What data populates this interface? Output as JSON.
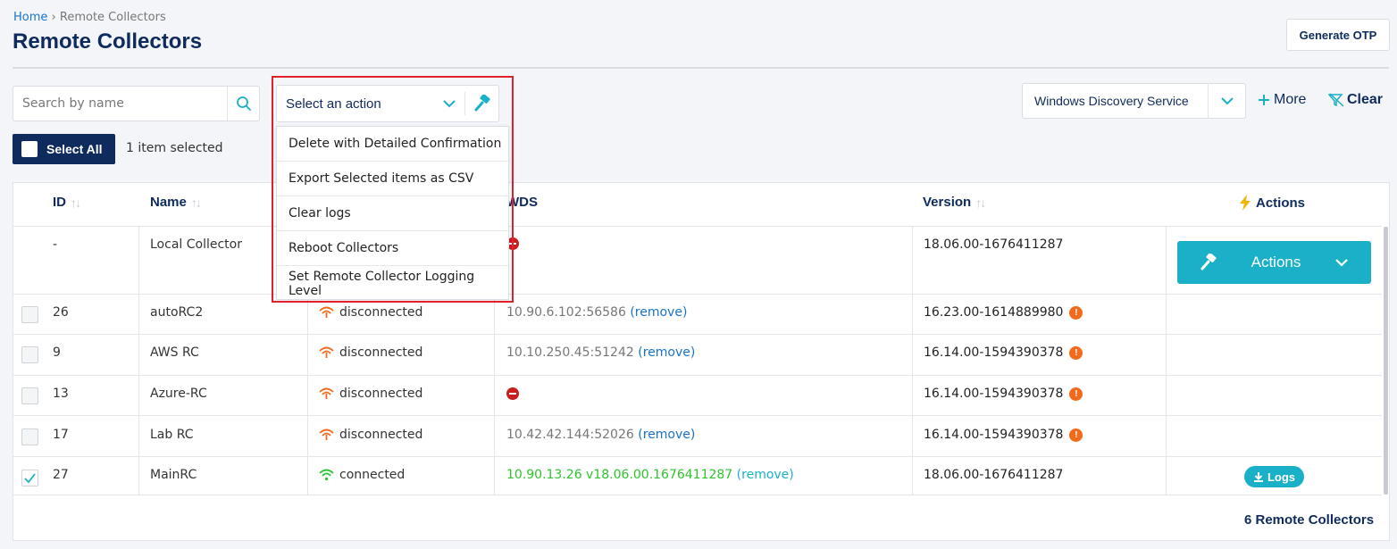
{
  "breadcrumb": {
    "home": "Home",
    "separator": "›",
    "current": "Remote Collectors"
  },
  "page_title": "Remote Collectors",
  "generate_otp_label": "Generate OTP",
  "search": {
    "placeholder": "Search by name"
  },
  "action_select": {
    "label": "Select an action",
    "options": [
      "Delete with Detailed Confirmation",
      "Export Selected items as CSV",
      "Clear logs",
      "Reboot Collectors",
      "Set Remote Collector Logging Level"
    ]
  },
  "filter": {
    "wds_label": "Windows Discovery Service",
    "more_label": "More",
    "clear_label": "Clear"
  },
  "selection": {
    "select_all_label": "Select All",
    "selected_text": "1 item selected"
  },
  "table": {
    "headers": {
      "id": "ID",
      "name": "Name",
      "wds": "WDS",
      "version": "Version",
      "actions": "Actions"
    },
    "rows": [
      {
        "id": "-",
        "name": "Local Collector",
        "status": "",
        "wds": "",
        "wds_remove": "",
        "version": "18.06.00-1676411287"
      },
      {
        "id": "26",
        "name": "autoRC2",
        "status": "disconnected",
        "wds": "10.90.6.102:56586",
        "wds_remove": "(remove)",
        "version": "16.23.00-1614889980"
      },
      {
        "id": "9",
        "name": "AWS RC",
        "status": "disconnected",
        "wds": "10.10.250.45:51242",
        "wds_remove": "(remove)",
        "version": "16.14.00-1594390378"
      },
      {
        "id": "13",
        "name": "Azure-RC",
        "status": "disconnected",
        "wds": "",
        "wds_remove": "",
        "version": "16.14.00-1594390378"
      },
      {
        "id": "17",
        "name": "Lab RC",
        "status": "disconnected",
        "wds": "10.42.42.144:52026",
        "wds_remove": "(remove)",
        "version": "16.14.00-1594390378"
      },
      {
        "id": "27",
        "name": "MainRC",
        "status": "connected",
        "wds": "10.90.13.26 v18.06.00.1676411287",
        "wds_remove": "(remove)",
        "version": "18.06.00-1676411287"
      }
    ],
    "actions_button_label": "Actions",
    "logs_button_label": "Logs",
    "footer_count": "6 Remote Collectors"
  },
  "colors": {
    "navy": "#0f2a5c",
    "teal": "#1ab0c8",
    "link_blue": "#1a73c9",
    "warning_orange": "#f26b1d",
    "connected_green": "#2cc52c",
    "error_red": "#c81e1e",
    "highlight_red": "#e0202a"
  },
  "icons": [
    "search-icon",
    "chevron-down-icon",
    "hammer-icon",
    "plus-icon",
    "filter-clear-icon",
    "lightning-icon",
    "wifi-disconnected-icon",
    "wifi-connected-icon",
    "no-entry-icon",
    "warning-icon",
    "download-icon",
    "check-icon"
  ]
}
